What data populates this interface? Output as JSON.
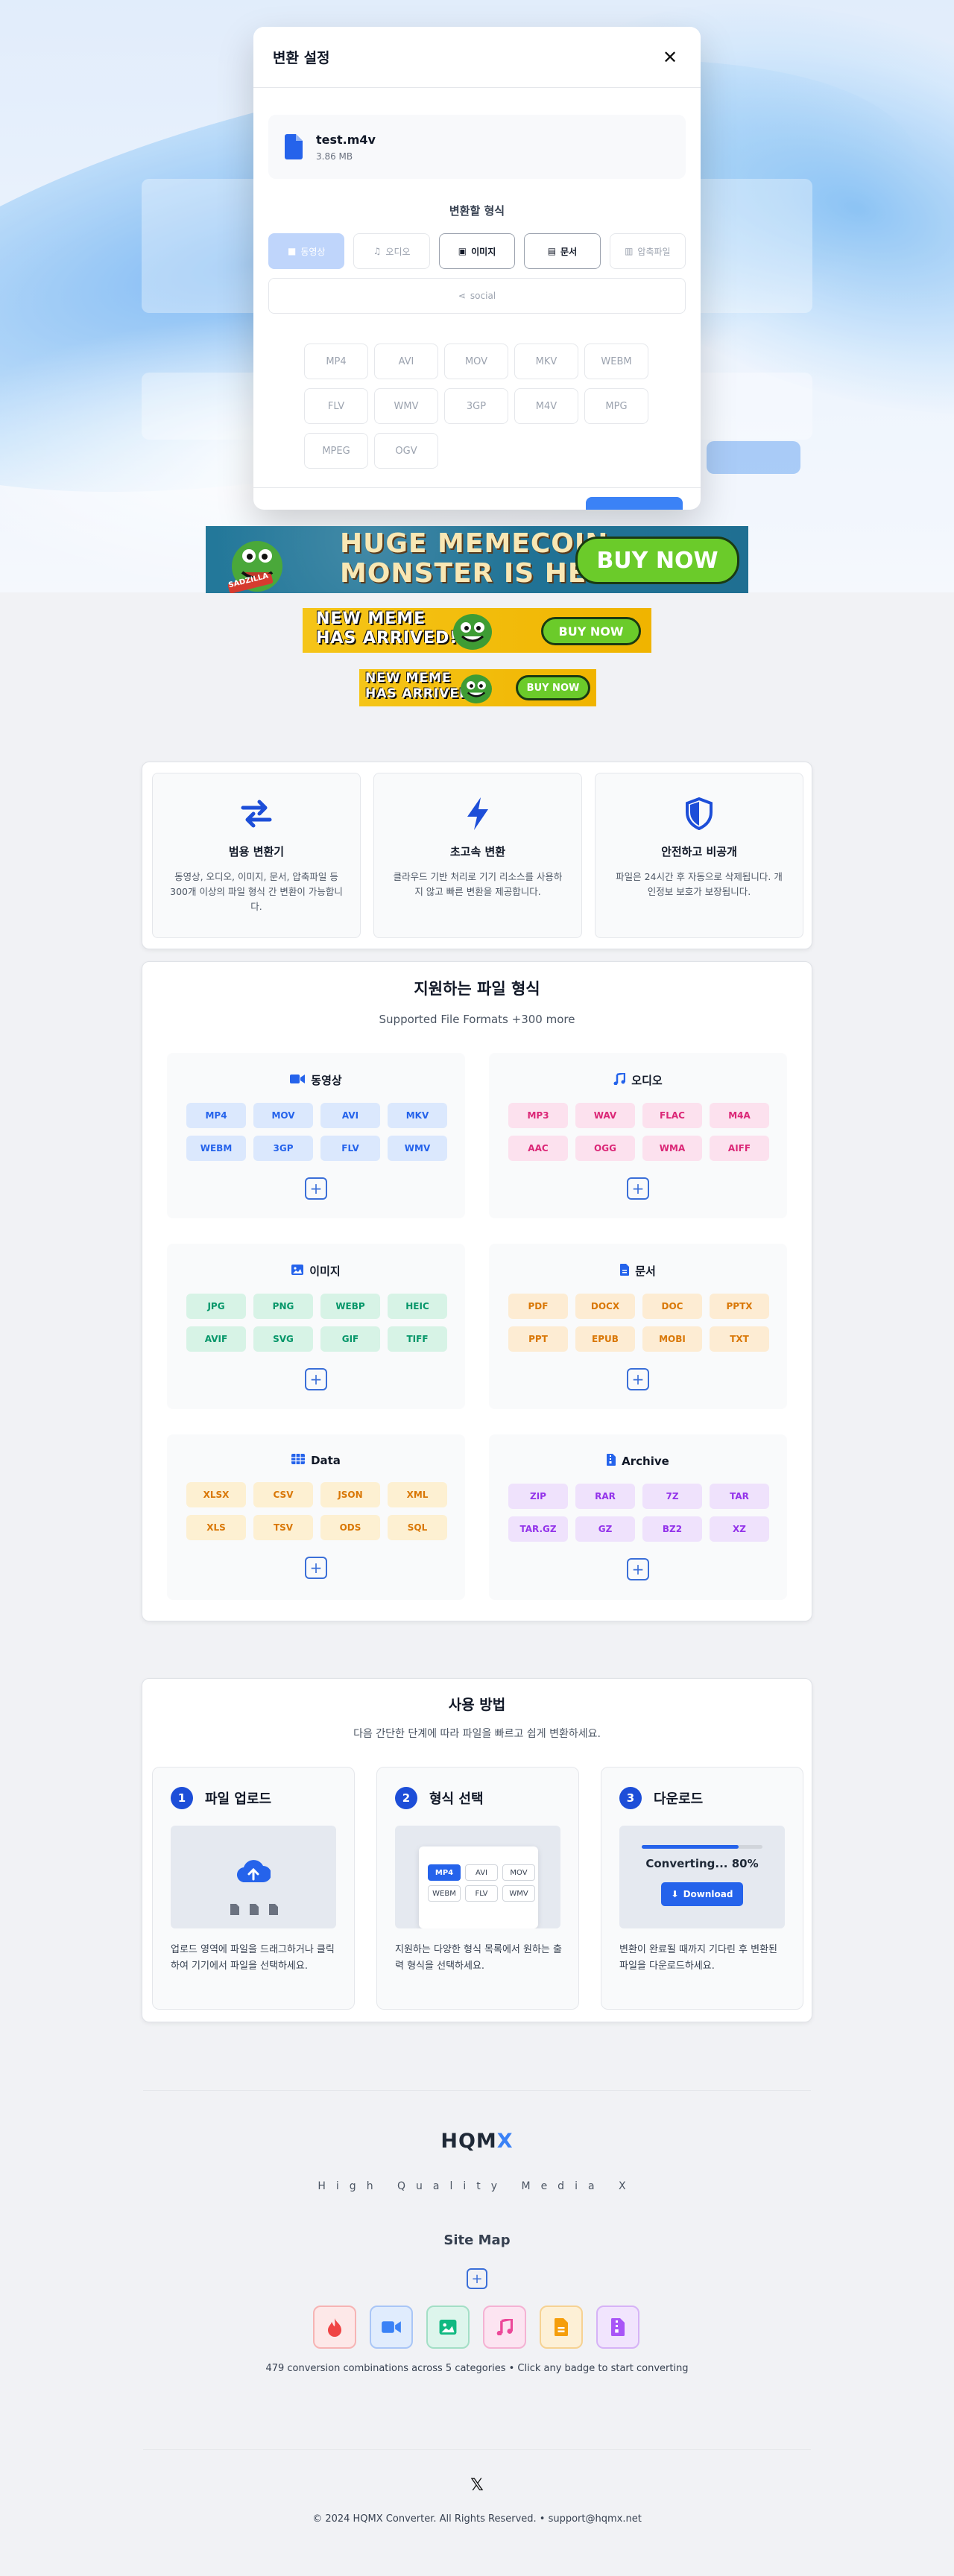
{
  "modal": {
    "title": "변환 설정",
    "close_icon": "x-icon",
    "file": {
      "name": "test.m4v",
      "size": "3.86 MB"
    },
    "format_section_title": "변환할 형식",
    "categories": [
      {
        "label": "동영상",
        "icon": "video-icon"
      },
      {
        "label": "오디오",
        "icon": "music-icon"
      },
      {
        "label": "이미지",
        "icon": "image-icon"
      },
      {
        "label": "문서",
        "icon": "document-icon"
      },
      {
        "label": "압축파일",
        "icon": "archive-icon"
      }
    ],
    "social_label": "social",
    "formats": [
      "MP4",
      "AVI",
      "MOV",
      "MKV",
      "WEBM",
      "FLV",
      "WMV",
      "3GP",
      "M4V",
      "MPG",
      "MPEG",
      "OGV"
    ]
  },
  "ads": {
    "ad1": {
      "line1": "HUGE MEMECOIN",
      "line2": "MONSTER IS HERE",
      "button": "BUY NOW",
      "tag": "SADZILLA"
    },
    "ad2": {
      "line1": "NEW MEME",
      "line2": "HAS ARRIVED!",
      "button": "BUY NOW"
    },
    "ad3": {
      "line1": "NEW MEME",
      "line2": "HAS ARRIVED!",
      "button": "BUY NOW"
    }
  },
  "features": [
    {
      "title": "범용 변환기",
      "desc": "동영상, 오디오, 이미지, 문서, 압축파일 등 300개 이상의 파일 형식 간 변환이 가능합니다.",
      "icon": "arrows-exchange-icon"
    },
    {
      "title": "초고속 변환",
      "desc": "클라우드 기반 처리로 기기 리소스를 사용하지 않고 빠른 변환을 제공합니다.",
      "icon": "lightning-icon"
    },
    {
      "title": "안전하고 비공개",
      "desc": "파일은 24시간 후 자동으로 삭제됩니다. 개인정보 보호가 보장됩니다.",
      "icon": "shield-icon"
    }
  ],
  "supported": {
    "title": "지원하는 파일 형식",
    "subtitle": "Supported File Formats +300 more",
    "groups": [
      {
        "title": "동영상",
        "icon": "video-icon",
        "color": "#2563eb",
        "bg": "#dbe8fd",
        "items": [
          "MP4",
          "MOV",
          "AVI",
          "MKV",
          "WEBM",
          "3GP",
          "FLV",
          "WMV"
        ]
      },
      {
        "title": "오디오",
        "icon": "music-icon",
        "color": "#db2777",
        "bg": "#fce1ee",
        "items": [
          "MP3",
          "WAV",
          "FLAC",
          "M4A",
          "AAC",
          "OGG",
          "WMA",
          "AIFF"
        ]
      },
      {
        "title": "이미지",
        "icon": "image-icon",
        "color": "#059669",
        "bg": "#d7f3e6",
        "items": [
          "JPG",
          "PNG",
          "WEBP",
          "HEIC",
          "AVIF",
          "SVG",
          "GIF",
          "TIFF"
        ]
      },
      {
        "title": "문서",
        "icon": "document-icon",
        "color": "#d97706",
        "bg": "#fdecd3",
        "items": [
          "PDF",
          "DOCX",
          "DOC",
          "PPTX",
          "PPT",
          "EPUB",
          "MOBI",
          "TXT"
        ]
      },
      {
        "title": "Data",
        "icon": "table-icon",
        "color": "#d97706",
        "bg": "#fdf0d2",
        "items": [
          "XLSX",
          "CSV",
          "JSON",
          "XML",
          "XLS",
          "TSV",
          "ODS",
          "SQL"
        ]
      },
      {
        "title": "Archive",
        "icon": "archive-icon",
        "color": "#9333ea",
        "bg": "#efe2fc",
        "items": [
          "ZIP",
          "RAR",
          "7Z",
          "TAR",
          "TAR.GZ",
          "GZ",
          "BZ2",
          "XZ"
        ]
      }
    ]
  },
  "howto": {
    "title": "사용 방법",
    "subtitle": "다음 간단한 단계에 따라 파일을 빠르고 쉽게 변환하세요.",
    "steps": [
      {
        "num": "1",
        "title": "파일 업로드",
        "desc": "업로드 영역에 파일을 드래그하거나 클릭하여 기기에서 파일을 선택하세요."
      },
      {
        "num": "2",
        "title": "형식 선택",
        "desc": "지원하는 다양한 형식 목록에서 원하는 출력 형식을 선택하세요.",
        "formats": [
          "MP4",
          "AVI",
          "MOV",
          "WEBM",
          "FLV",
          "WMV"
        ]
      },
      {
        "num": "3",
        "title": "다운로드",
        "desc": "변환이 완료될 때까지 기다린 후 변환된 파일을 다운로드하세요.",
        "status": "Converting... 80%",
        "progress": 0.8,
        "button": "Download"
      }
    ]
  },
  "footer": {
    "logo_main": "HQM",
    "logo_accent": "X",
    "tagline": "High Quality Media X",
    "sitemap_title": "Site Map",
    "icons": [
      {
        "name": "fire-icon",
        "color": "#ef4444",
        "bg": "#fde8e8"
      },
      {
        "name": "video-icon",
        "color": "#3b82f6",
        "bg": "#e0ecfd"
      },
      {
        "name": "image-icon",
        "color": "#10b981",
        "bg": "#ddf5ec"
      },
      {
        "name": "music-icon",
        "color": "#ec4899",
        "bg": "#fce4f1"
      },
      {
        "name": "document-icon",
        "color": "#f59e0b",
        "bg": "#fdf0d6"
      },
      {
        "name": "archive-icon",
        "color": "#a855f7",
        "bg": "#f1e4fd"
      }
    ],
    "combinations": "479 conversion combinations across 5 categories • Click any badge to start converting",
    "social_icon": "x-logo-icon",
    "copyright": "© 2024 HQMX Converter. All Rights Reserved. • support@hqmx.net"
  }
}
